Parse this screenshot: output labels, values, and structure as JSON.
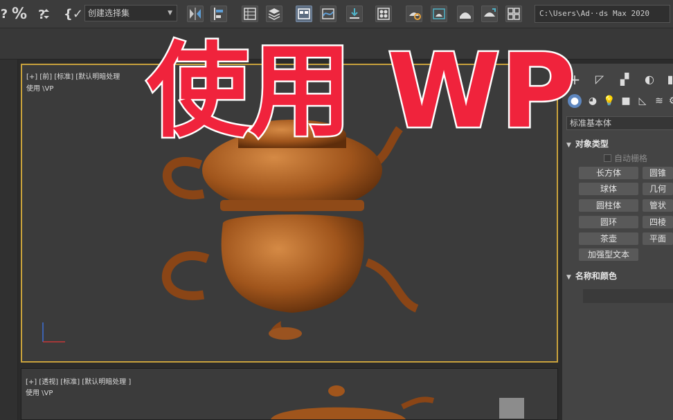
{
  "toolbar": {
    "selection_set_label": "创建选择集",
    "path_label": "C:\\Users\\Ad··ds Max 2020"
  },
  "viewport_front": {
    "label": "[+] [前] [标准] [默认明暗处理",
    "sublabel": "使用 \\VP"
  },
  "viewport_persp": {
    "label": "[+] [透视] [标准] [默认明暗处理 ]",
    "sublabel": "使用 \\VP"
  },
  "command_panel": {
    "category": "标准基本体",
    "object_type_header": "对象类型",
    "auto_grid_label": "自动栅格",
    "primitives": [
      "长方体",
      "圆锥",
      "球体",
      "几何",
      "圆柱体",
      "管状",
      "圆环",
      "四棱",
      "茶壶",
      "平面",
      "加强型文本"
    ],
    "name_color_header": "名称和颜色"
  },
  "overlay_caption": "使用 WP",
  "colors": {
    "active_viewport_border": "#c9a23c",
    "overlay_text": "#f0233c",
    "teapot": "#a0551c",
    "active_tab": "#5e87bf"
  }
}
